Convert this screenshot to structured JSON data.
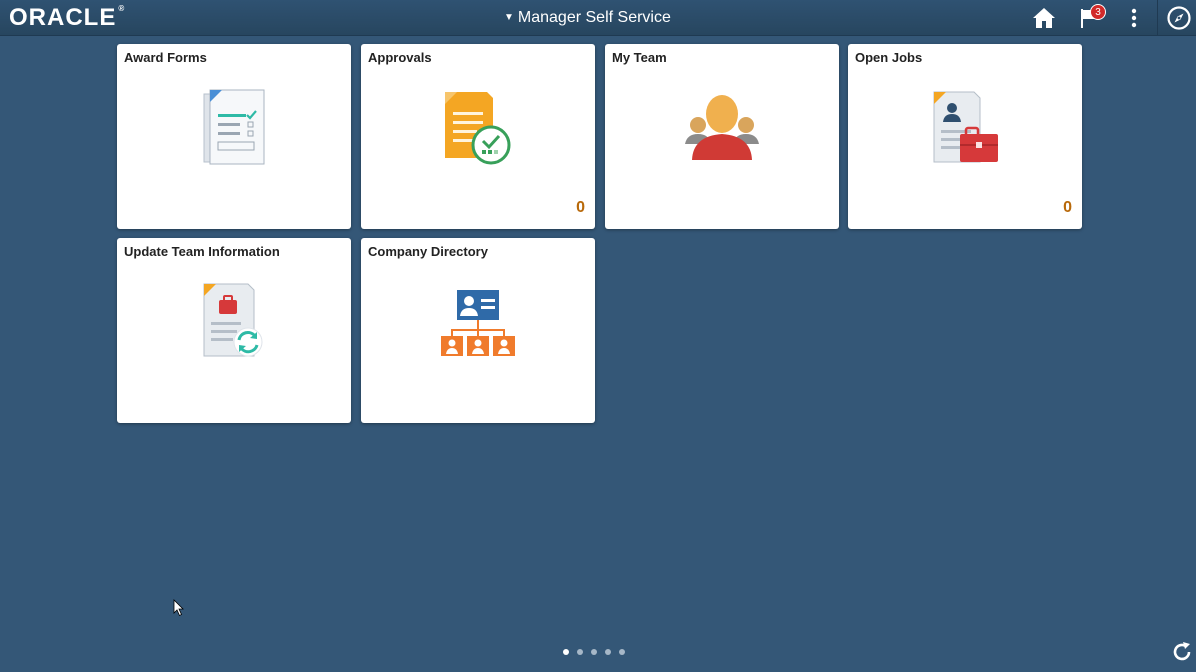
{
  "header": {
    "logo_text": "ORACLE",
    "logo_mark": "®",
    "title": "Manager Self Service",
    "notification_count": "3",
    "icons": [
      "home-icon",
      "notification-flag-icon",
      "actions-menu-icon",
      "navbar-compass-icon"
    ]
  },
  "tiles": [
    {
      "title": "Award Forms",
      "icon": "award-forms-icon",
      "count": ""
    },
    {
      "title": "Approvals",
      "icon": "approvals-icon",
      "count": "0"
    },
    {
      "title": "My Team",
      "icon": "my-team-icon",
      "count": ""
    },
    {
      "title": "Open Jobs",
      "icon": "open-jobs-icon",
      "count": "0"
    },
    {
      "title": "Update Team Information",
      "icon": "update-team-info-icon",
      "count": ""
    },
    {
      "title": "Company Directory",
      "icon": "company-directory-icon",
      "count": ""
    }
  ],
  "pagination": {
    "pages": 5,
    "active": 1
  },
  "colors": {
    "background": "#345777",
    "count": "#b8690a",
    "badge": "#d22a2a"
  }
}
